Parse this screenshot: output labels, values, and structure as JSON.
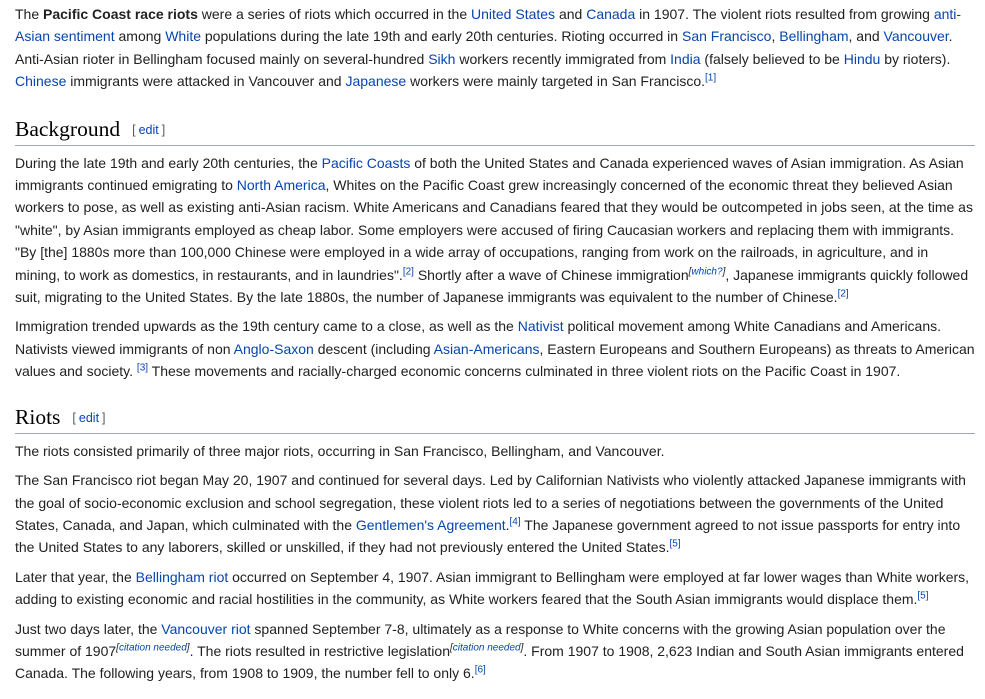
{
  "intro": {
    "s0": "The ",
    "bold": "Pacific Coast race riots",
    "s1": " were a series of riots which occurred in the ",
    "l_us": "United States",
    "s2": " and ",
    "l_canada": "Canada",
    "s3": " in 1907. The violent riots resulted from growing ",
    "l_anti": "anti-Asian sentiment",
    "s4": " among ",
    "l_white": "White",
    "s5": " populations during the late 19th and early 20th centuries. Rioting occurred in ",
    "l_sf": "San Francisco",
    "s6": ", ",
    "l_bellingham": "Bellingham",
    "s7": ", and ",
    "l_vancouver": "Vancouver",
    "s8": ". Anti-Asian rioter in Bellingham focused mainly on several-hundred ",
    "l_sikh": "Sikh",
    "s9": " workers recently immigrated from ",
    "l_india": "India",
    "s10": " (falsely believed to be ",
    "l_hindu": "Hindu",
    "s11": " by rioters). ",
    "l_chinese": "Chinese",
    "s12": " immigrants were attacked in Vancouver and ",
    "l_japanese": "Japanese",
    "s13": " workers were mainly targeted in San Francisco.",
    "ref1": "[1]"
  },
  "edit": {
    "open": "[",
    "label": "edit",
    "close": "]"
  },
  "background": {
    "heading": "Background",
    "p1": {
      "s0": "During the late 19th and early 20th centuries, the ",
      "l_pc": "Pacific Coasts",
      "s1": " of both the United States and Canada experienced waves of Asian immigration. As Asian immigrants continued emigrating to ",
      "l_na": "North America",
      "s2": ", Whites on the Pacific Coast grew increasingly concerned of the economic threat they believed Asian workers to pose, as well as existing anti-Asian racism. White Americans and Canadians feared that they would be outcompeted in jobs seen, at the time as \"white\", by Asian immigrants employed as cheap labor. Some employers were accused of firing Caucasian workers and replacing them with immigrants. \"By [the] 1880s more than 100,000 Chinese were employed in a wide array of occupations, ranging from work on the railroads, in agriculture, and in mining, to work as domestics, in restaurants, and in laundries\".",
      "ref2a": "[2]",
      "s3": " Shortly after a wave of Chinese immigration",
      "which_open": "[",
      "which": "which?",
      "which_close": "]",
      "s4": ", Japanese immigrants quickly followed suit, migrating to the United States. By the late 1880s, the number of Japanese immigrants was equivalent to the number of Chinese.",
      "ref2b": "[2]"
    },
    "p2": {
      "s0": "Immigration trended upwards as the 19th century came to a close, as well as the ",
      "l_nativist": "Nativist",
      "s1": " political movement among White Canadians and Americans. Nativists viewed immigrants of non ",
      "l_anglo": "Anglo-Saxon",
      "s2": " descent (including ",
      "l_asianam": "Asian-Americans",
      "s3": ", Eastern Europeans and Southern Europeans) as threats to American values and society. ",
      "ref3": "[3]",
      "s4": " These movements and racially-charged economic concerns culminated in three violent riots on the Pacific Coast in 1907."
    }
  },
  "riots": {
    "heading": "Riots",
    "p1": "The riots consisted primarily of three major riots, occurring in San Francisco, Bellingham, and Vancouver.",
    "p2": {
      "s0": "The San Francisco riot began May 20, 1907 and continued for several days. Led by Californian Nativists who violently attacked Japanese immigrants with the goal of socio-economic exclusion and school segregation, these violent riots led to a series of negotiations between the governments of the United States, Canada, and Japan, which culminated with the ",
      "l_gent": "Gentlemen's Agreement",
      "s1": ".",
      "ref4": "[4]",
      "s2": " The Japanese government agreed to not issue passports for entry into the United States to any laborers, skilled or unskilled, if they had not previously entered the United States.",
      "ref5a": "[5]"
    },
    "p3": {
      "s0": "Later that year, the ",
      "l_bell": "Bellingham riot",
      "s1": " occurred on September 4, 1907. Asian immigrant to Bellingham were employed at far lower wages than White workers, adding to existing economic and racial hostilities in the community, as White workers feared that the South Asian immigrants would displace them.",
      "ref5b": "[5]"
    },
    "p4": {
      "s0": "Just two days later, the ",
      "l_van": "Vancouver riot",
      "s1": " spanned September 7-8, ultimately as a response to White concerns with the growing Asian population over the summer of 1907",
      "cn_open": "[",
      "cn": "citation needed",
      "cn_close": "]",
      "s2": ". The riots resulted in restrictive legislation",
      "s3": ". From 1907 to 1908, 2,623 Indian and South Asian immigrants entered Canada. The following years, from 1908 to 1909, the number fell to only 6.",
      "ref6": "[6]"
    }
  }
}
